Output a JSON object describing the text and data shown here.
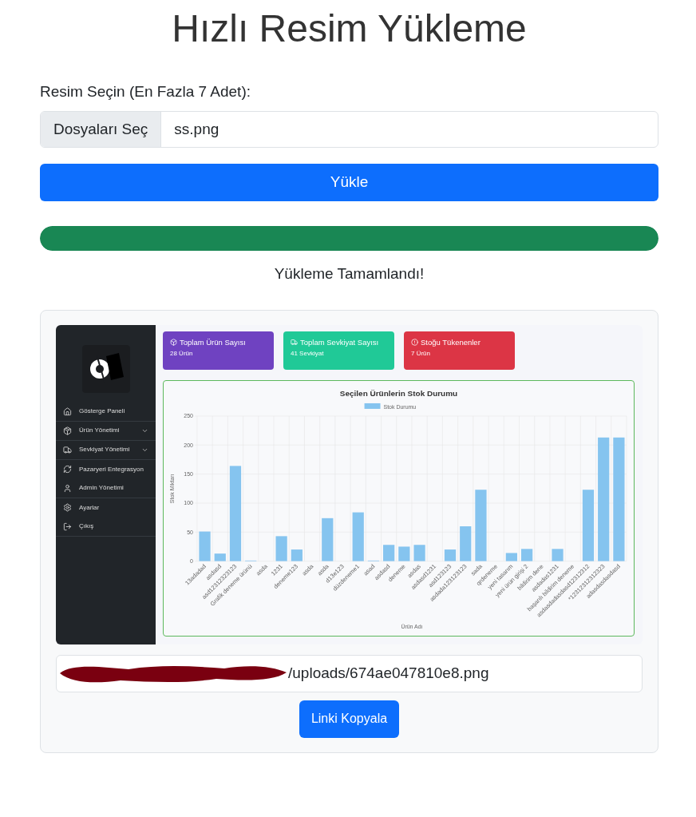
{
  "title": "Hızlı Resim Yükleme",
  "file_label": "Resim Seçin (En Fazla 7 Adet):",
  "file_input": {
    "button": "Dosyaları Seç",
    "value": "ss.png"
  },
  "upload_button": "Yükle",
  "progress": {
    "level": 1
  },
  "status": "Yükleme Tamamlandı!",
  "preview": {
    "sidebar": {
      "items": [
        {
          "label": "Gösterge Paneli",
          "submenu": false
        },
        {
          "label": "Ürün Yönetimi",
          "submenu": true
        },
        {
          "label": "Sevkiyat Yönetimi",
          "submenu": true
        },
        {
          "label": "Pazaryeri Entegrasyon",
          "submenu": false
        },
        {
          "label": "Admin Yönetimi",
          "submenu": false
        },
        {
          "label": "Ayarlar",
          "submenu": false
        },
        {
          "label": "Çıkış",
          "submenu": false
        }
      ]
    },
    "cards": [
      {
        "title": "Toplam Ürün Sayısı",
        "value": "28 Ürün",
        "color": "#6f42c1"
      },
      {
        "title": "Toplam Sevkiyat Sayısı",
        "value": "41 Sevkiyat",
        "color": "#20c997"
      },
      {
        "title": "Stoğu Tükenenler",
        "value": "7 Ürün",
        "color": "#dc3545"
      }
    ],
    "chart_data": {
      "type": "bar",
      "title": "Seçilen Ürünlerin Stok Durumu",
      "xlabel": "Ürün Adı",
      "ylabel": "Stok Miktarı",
      "categories": [
        "13adadad",
        "asdasd",
        "asd12312323123",
        "Grafik deneme ürünü",
        "asda",
        "1231",
        "deneme123",
        "asda",
        "asda",
        "d13e123",
        "düzdeneme1",
        "asad",
        "asdasd",
        "deneme",
        "asdas",
        "asdasd1231",
        "asd123123",
        "asdada123123123",
        "sada",
        "qrdeneme",
        "yeni tasarım",
        "yeni ürün girişi 2",
        "bildirim dene",
        "asdadas1231",
        "başarılı bildirim deneme",
        "asdasdadasdasd12312312",
        "*12312312312323",
        "adasdasdasdasd"
      ],
      "series": [
        {
          "name": "Stok Durumu",
          "color": "#85c4ef",
          "values": [
            51,
            13,
            164,
            1,
            0,
            43,
            20,
            0,
            74,
            0,
            84,
            1,
            28,
            25,
            28,
            0,
            20,
            60,
            123,
            0,
            14,
            21,
            0,
            21,
            0,
            123,
            213,
            213
          ]
        }
      ],
      "grid": true,
      "ylim": [
        0,
        250
      ],
      "yticks": [
        0,
        50,
        100,
        150,
        200,
        250
      ]
    }
  },
  "link": {
    "value": "/uploads/674ae047810e8.png"
  },
  "copy_button": "Linki Kopyala"
}
